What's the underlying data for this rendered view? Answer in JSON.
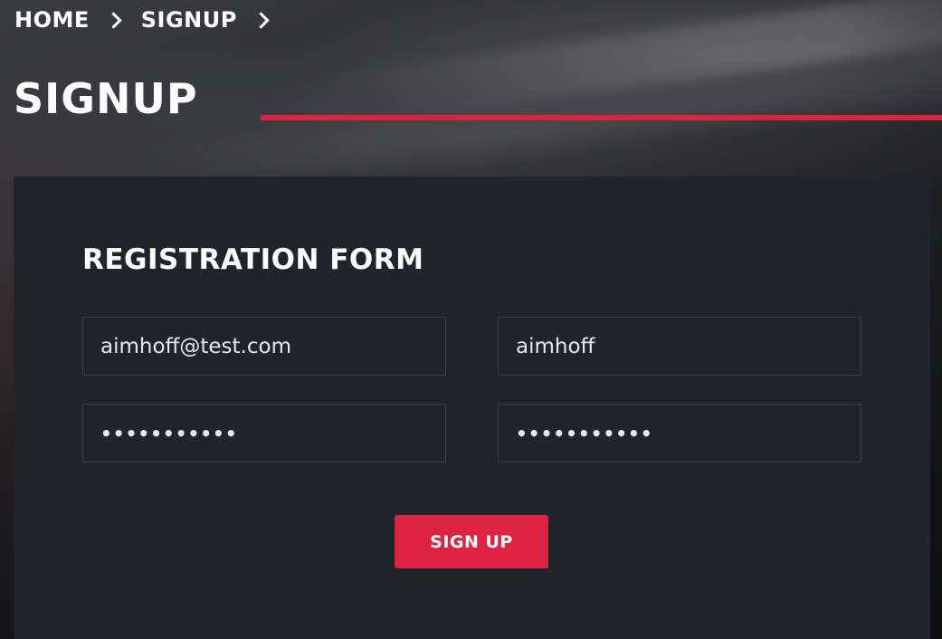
{
  "breadcrumb": {
    "items": [
      "HOME",
      "SIGNUP"
    ]
  },
  "page": {
    "title": "SIGNUP"
  },
  "form": {
    "title": "REGISTRATION FORM",
    "email_value": "aimhoff@test.com",
    "username_value": "aimhoff",
    "password_value": "•••••••••••",
    "confirm_password_value": "•••••••••••",
    "submit_label": "SIGN UP"
  },
  "colors": {
    "accent": "#dc2342",
    "card_bg": "#21252b",
    "field_border": "#3a3f47",
    "text": "#ffffff"
  },
  "icons": {
    "breadcrumb_separator": "chevron-right-icon"
  }
}
